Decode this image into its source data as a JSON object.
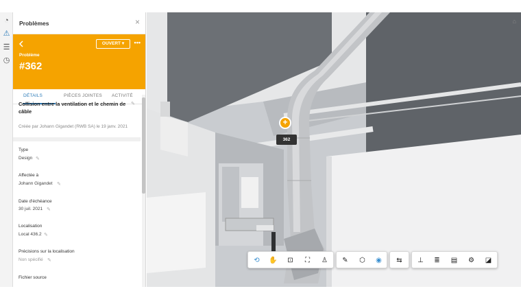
{
  "rail": {
    "icons": [
      "gauge-icon",
      "warning-icon",
      "list-icon",
      "clock-icon"
    ]
  },
  "panel": {
    "title": "Problèmes",
    "close_glyph": "×",
    "status_label": "OUVERT ▾",
    "more_glyph": "•••",
    "issue_kind": "Problème",
    "issue_number": "#362",
    "tabs": [
      {
        "label": "DÉTAILS"
      },
      {
        "label": "PIÈCES JOINTES"
      },
      {
        "label": "ACTIVITÉ"
      }
    ],
    "issue_title": "Collision entre la ventilation et le chemin de câble",
    "created_by": "Créée par Johann Gigandet (RWB SA) le 19 janv. 2021",
    "fields": [
      {
        "label": "Type",
        "value": "Design"
      },
      {
        "label": "Affectée à",
        "value": "Johann Gigandet"
      },
      {
        "label": "Date d'échéance",
        "value": "30 juil. 2021"
      },
      {
        "label": "Localisation",
        "value": "Local 436.2"
      },
      {
        "label": "Précisions sur la localisation",
        "value": "Non spécifié"
      },
      {
        "label": "Fichier source",
        "value": ""
      }
    ]
  },
  "viewer": {
    "marker_label": "362",
    "accent": "#f5a300"
  },
  "toolbar": {
    "groups": [
      [
        "orbit-icon",
        "pan-hand-icon",
        "zoom-icon",
        "fit-view-icon",
        "first-person-icon"
      ],
      [
        "measure-icon",
        "section-box-icon",
        "explode-icon"
      ],
      [
        "compare-icon"
      ],
      [
        "model-tree-icon",
        "layers-icon",
        "properties-icon",
        "settings-icon",
        "fullscreen-icon"
      ]
    ]
  }
}
